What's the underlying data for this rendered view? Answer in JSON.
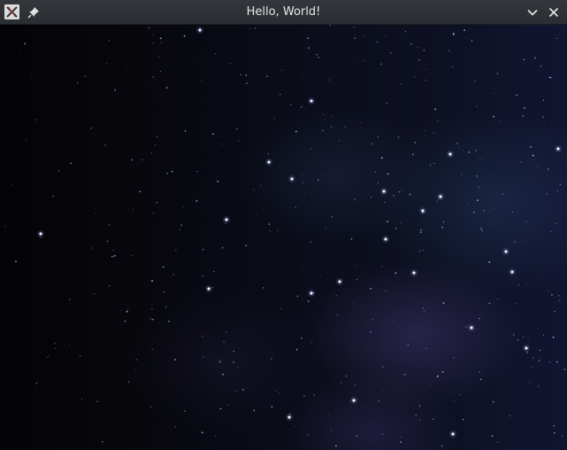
{
  "window": {
    "title": "Hello, World!"
  },
  "icons": {
    "app": "x-window-icon",
    "pin": "pin-icon",
    "minimize": "chevron-down-icon",
    "close": "close-icon"
  },
  "colors": {
    "titlebar": "#2e3136",
    "title_text": "#e6e6e6",
    "space_background": "#07080f"
  }
}
